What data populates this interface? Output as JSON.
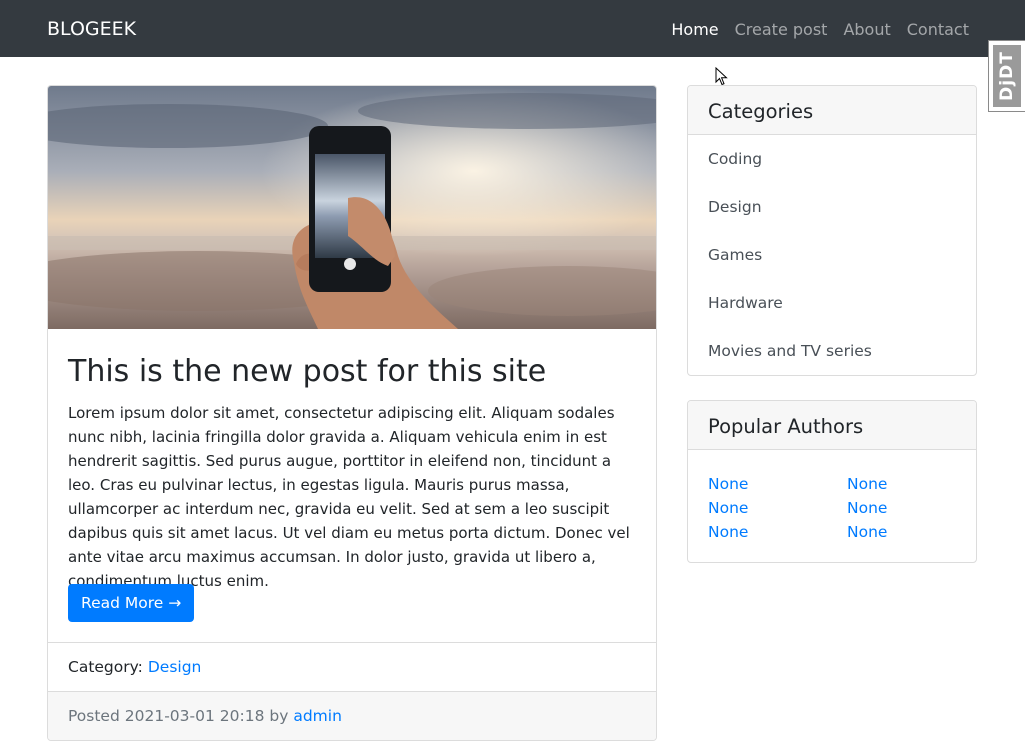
{
  "navbar": {
    "brand": "BLOGEEK",
    "links": [
      {
        "label": "Home",
        "active": true
      },
      {
        "label": "Create post",
        "active": false
      },
      {
        "label": "About",
        "active": false
      },
      {
        "label": "Contact",
        "active": false
      }
    ]
  },
  "debug_toolbar": {
    "label": "DjDT"
  },
  "post": {
    "title": "This is the new post for this site",
    "body": "Lorem ipsum dolor sit amet, consectetur adipiscing elit. Aliquam sodales nunc nibh, lacinia fringilla dolor gravida a. Aliquam vehicula enim in est hendrerit sagittis. Sed purus augue, porttitor in eleifend non, tincidunt a leo. Cras eu pulvinar lectus, in egestas ligula. Mauris purus massa, ullamcorper ac interdum nec, gravida eu velit. Sed at sem a leo suscipit dapibus quis sit amet lacus. Ut vel diam eu metus porta dictum. Donec vel ante vitae arcu maximus accumsan. In dolor justo, gravida ut libero a, condimentum luctus enim.",
    "read_more": "Read More →",
    "category_label": "Category:",
    "category": "Design",
    "posted_prefix": "Posted",
    "posted_date": "2021-03-01 20:18",
    "by": "by",
    "author": "admin"
  },
  "categories": {
    "title": "Categories",
    "items": [
      "Coding",
      "Design",
      "Games",
      "Hardware",
      "Movies and TV series"
    ]
  },
  "authors": {
    "title": "Popular Authors",
    "items": [
      "None",
      "None",
      "None",
      "None",
      "None",
      "None"
    ]
  },
  "colors": {
    "navbar_bg": "#343a40",
    "primary": "#007bff",
    "card_header_bg": "#f7f7f7",
    "muted": "#6c757d"
  }
}
